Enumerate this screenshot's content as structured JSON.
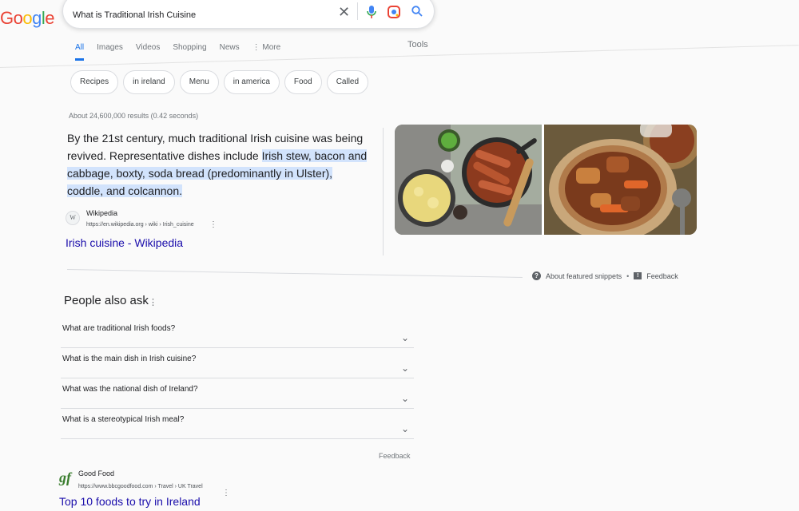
{
  "logo": {
    "text": "Google"
  },
  "search": {
    "query": "What is Traditional Irish Cuisine"
  },
  "tabs": [
    {
      "label": "All",
      "active": true
    },
    {
      "label": "Images"
    },
    {
      "label": "Videos"
    },
    {
      "label": "Shopping"
    },
    {
      "label": "News"
    },
    {
      "label": "More"
    }
  ],
  "tools_label": "Tools",
  "chips": [
    "Recipes",
    "in ireland",
    "Menu",
    "in america",
    "Food",
    "Called"
  ],
  "results_stats": "About 24,600,000 results (0.42 seconds)",
  "featured_snippet": {
    "text_before": "By the 21st century, much traditional Irish cuisine was being revived. Representative dishes include ",
    "text_highlight": "Irish stew, bacon and cabbage, boxty, soda bread (predominantly in Ulster), coddle, and colcannon.",
    "source_name": "Wikipedia",
    "source_url": "https://en.wikipedia.org › wiki › Irish_cuisine",
    "link_title": "Irish cuisine - Wikipedia",
    "about_label": "About featured snippets",
    "feedback_label": "Feedback"
  },
  "people_also_ask": {
    "title": "People also ask",
    "questions": [
      "What are traditional Irish foods?",
      "What is the main dish in Irish cuisine?",
      "What was the national dish of Ireland?",
      "What is a stereotypical Irish meal?"
    ],
    "feedback_label": "Feedback"
  },
  "result2": {
    "source_name": "Good Food",
    "url": "https://www.bbcgoodfood.com › Travel › UK Travel",
    "title": "Top 10 foods to try in Ireland",
    "icon_text": "gf"
  },
  "colors": {
    "accent": "#1a73e8",
    "link": "#1a0dab",
    "highlight": "#d2e3fc"
  }
}
